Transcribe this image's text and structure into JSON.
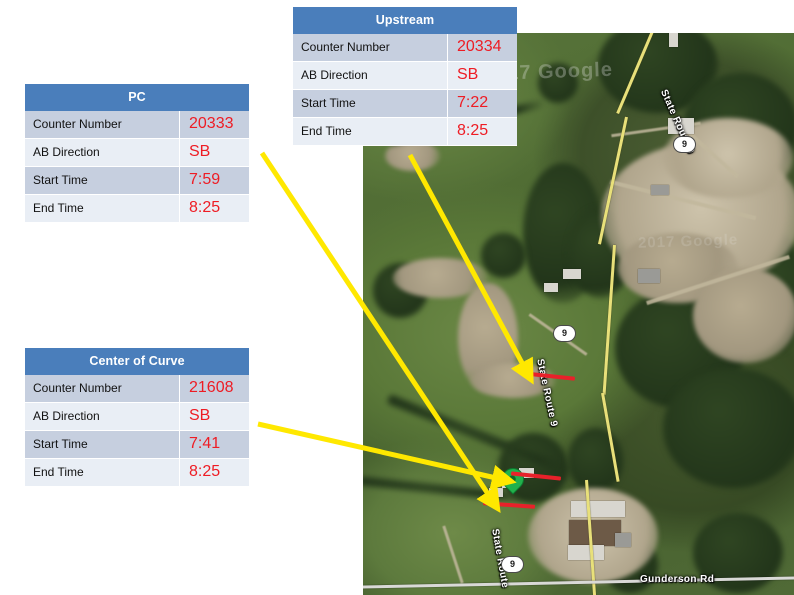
{
  "tables": [
    {
      "id": "upstream",
      "title": "Upstream",
      "rows": [
        {
          "label": "Counter Number",
          "value": "20334"
        },
        {
          "label": "AB Direction",
          "value": "SB"
        },
        {
          "label": "Start Time",
          "value": "7:22"
        },
        {
          "label": "End Time",
          "value": "8:25"
        }
      ]
    },
    {
      "id": "pc",
      "title": "PC",
      "rows": [
        {
          "label": "Counter Number",
          "value": "20333"
        },
        {
          "label": "AB Direction",
          "value": "SB"
        },
        {
          "label": "Start Time",
          "value": "7:59"
        },
        {
          "label": "End Time",
          "value": "8:25"
        }
      ]
    },
    {
      "id": "coc",
      "title": "Center of Curve",
      "rows": [
        {
          "label": "Counter Number",
          "value": "21608"
        },
        {
          "label": "AB Direction",
          "value": "SB"
        },
        {
          "label": "Start Time",
          "value": "7:41"
        },
        {
          "label": "End Time",
          "value": "8:25"
        }
      ]
    }
  ],
  "map": {
    "provider_watermark": "2017 Google",
    "road_labels": [
      {
        "name": "state-route-9-north",
        "text": "State Route 9"
      },
      {
        "name": "state-route-9-middle",
        "text": "State Route 9"
      },
      {
        "name": "state-route-9-south",
        "text": "State Route"
      },
      {
        "name": "gunderson-rd",
        "text": "Gunderson Rd"
      }
    ],
    "route_shields": [
      {
        "name": "route-shield-north",
        "text": "9"
      },
      {
        "name": "route-shield-middle",
        "text": "9"
      },
      {
        "name": "route-shield-south",
        "text": "9"
      }
    ],
    "markers": [
      {
        "name": "center-of-curve-pin",
        "type": "green-map-pin"
      }
    ],
    "counter_locations": [
      {
        "name": "upstream-counter",
        "type": "red-tick"
      },
      {
        "name": "pc-counter",
        "type": "red-tick"
      },
      {
        "name": "center-of-curve-counter",
        "type": "red-tick"
      }
    ]
  },
  "annotations": {
    "arrow_color": "#ffe800",
    "arrows": [
      {
        "name": "upstream-arrow",
        "from_table": "Upstream",
        "to": "upstream-counter"
      },
      {
        "name": "pc-arrow",
        "from_table": "PC",
        "to": "pc-counter"
      },
      {
        "name": "center-of-curve-arrow",
        "from_table": "Center of Curve",
        "to": "center-of-curve-counter"
      }
    ]
  },
  "colors": {
    "header_blue": "#4a7ebb",
    "row_dark": "#c6cfdf",
    "row_light": "#e9eef5",
    "value_red": "#ee1c24",
    "arrow_yellow": "#ffe800",
    "marker_green": "#22b14c"
  }
}
